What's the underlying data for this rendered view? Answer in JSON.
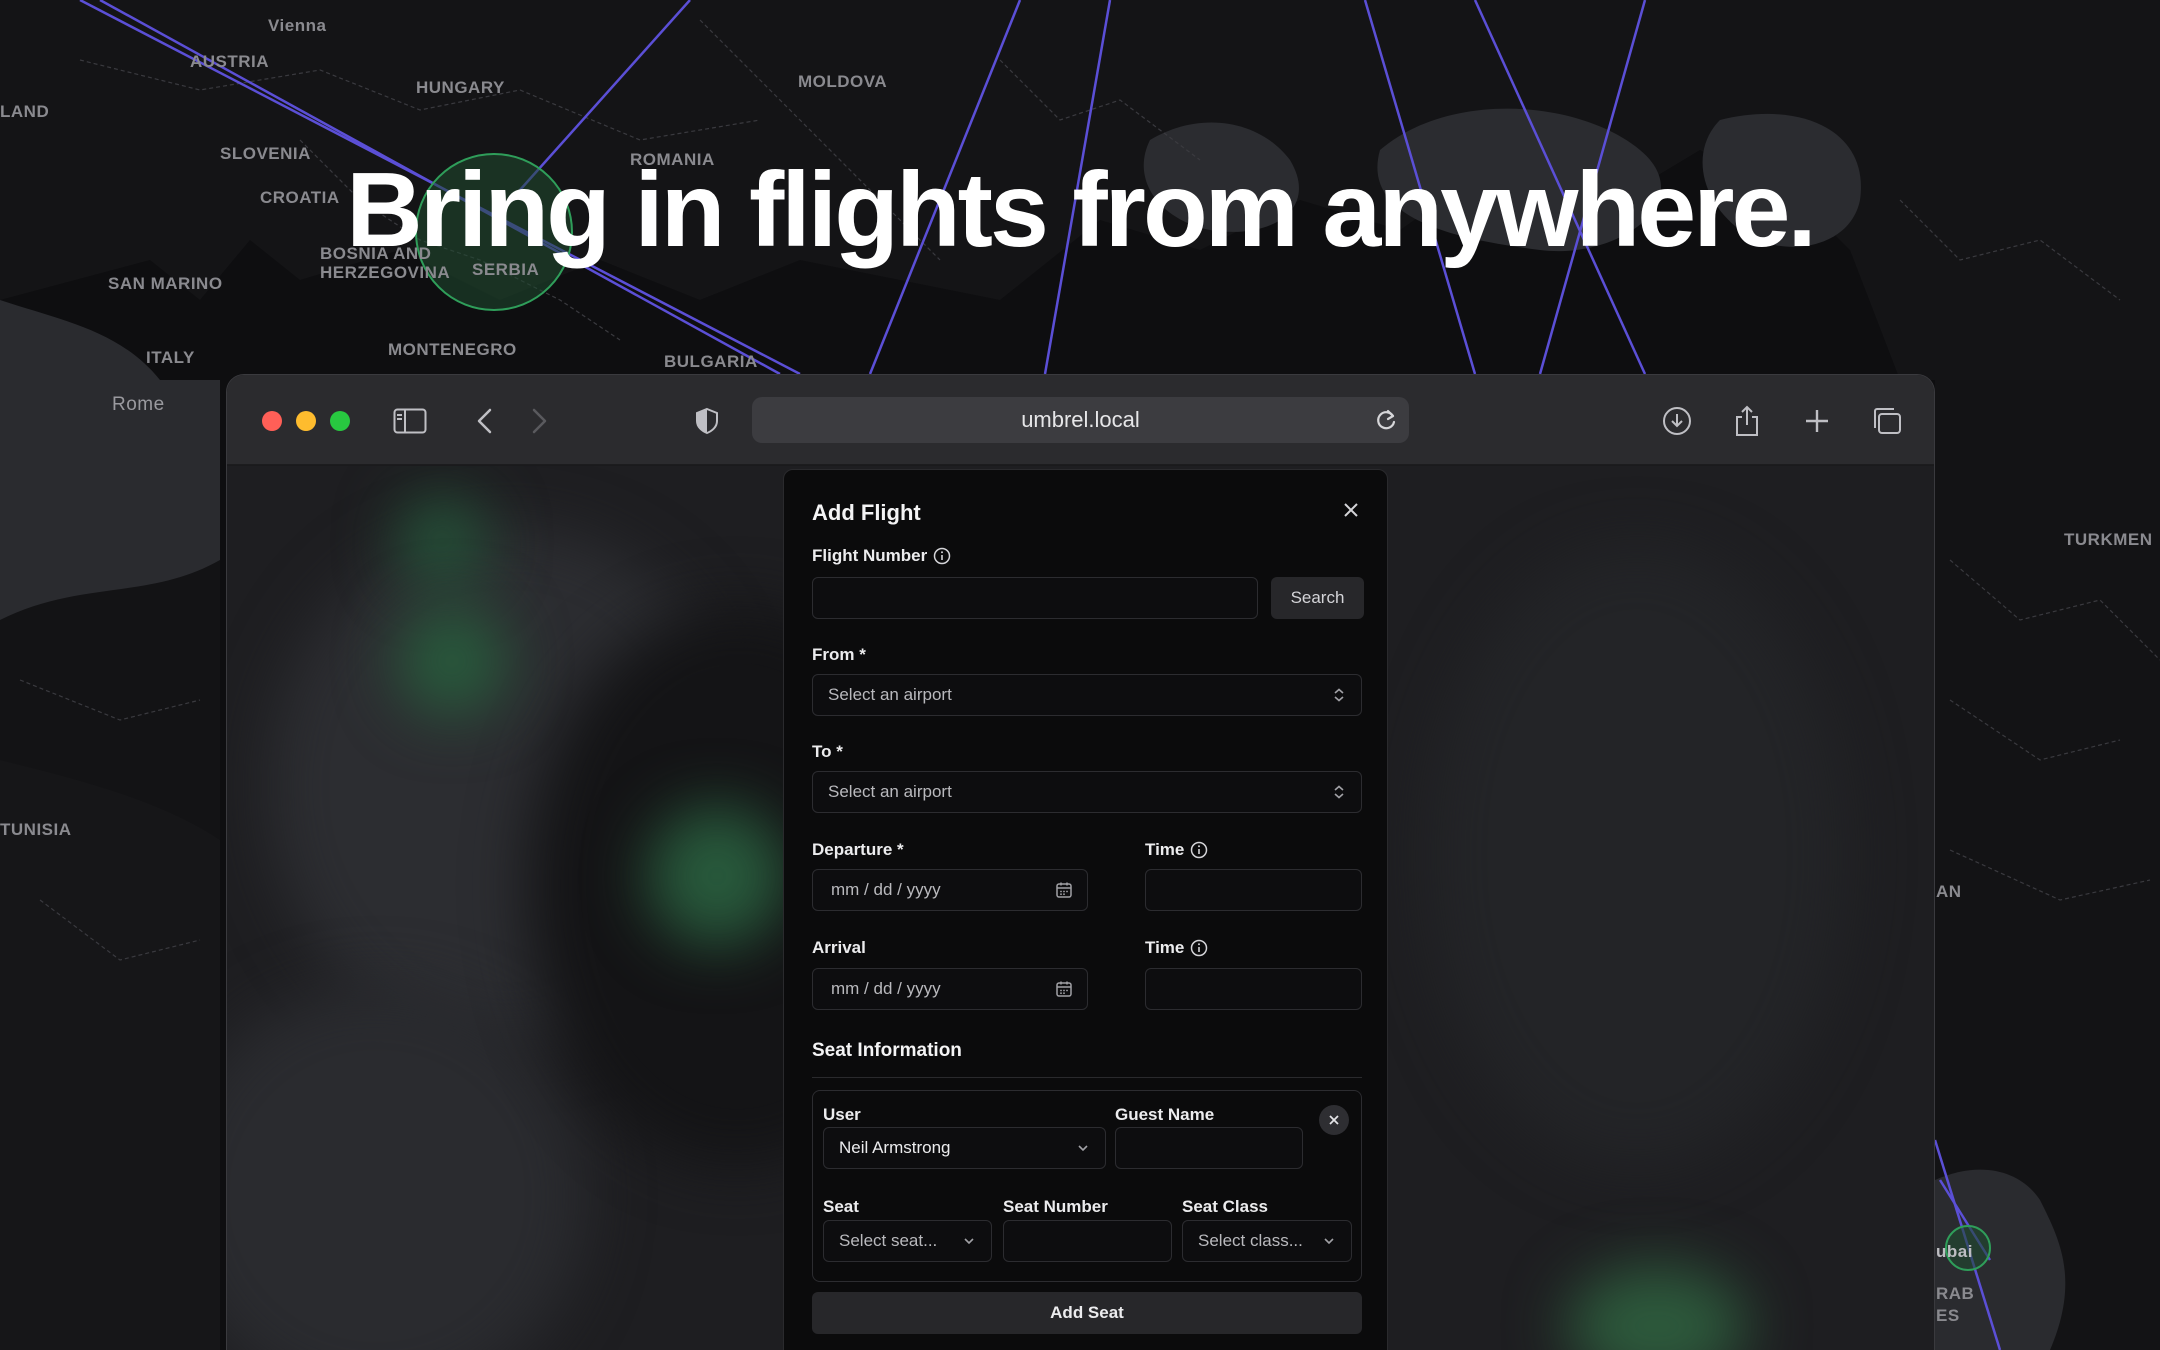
{
  "headline": "Bring in flights from anywhere.",
  "map_labels": {
    "vienna": "Vienna",
    "austria": "AUSTRIA",
    "hungary": "HUNGARY",
    "moldova": "MOLDOVA",
    "land": "LAND",
    "romania": "ROMANIA",
    "slovenia": "SLOVENIA",
    "croatia": "CROATIA",
    "bosnia": "BOSNIA AND\nHERZEGOVINA",
    "serbia": "SERBIA",
    "san_marino": "SAN MARINO",
    "italy": "ITALY",
    "montenegro": "MONTENEGRO",
    "bulgaria": "BULGARIA",
    "rome": "Rome",
    "turkmen": "TURKMEN",
    "tunisia": "TUNISIA",
    "an": "AN",
    "dubai": "ubai",
    "arab": "RAB",
    "es": "ES"
  },
  "browser": {
    "url": "umbrel.local"
  },
  "modal": {
    "title": "Add Flight",
    "flight_number_label": "Flight Number",
    "search_label": "Search",
    "from_label": "From *",
    "from_placeholder": "Select an airport",
    "to_label": "To *",
    "to_placeholder": "Select an airport",
    "departure_label": "Departure *",
    "departure_placeholder": "mm / dd / yyyy",
    "dep_time_label": "Time",
    "arrival_label": "Arrival",
    "arrival_placeholder": "mm / dd / yyyy",
    "arr_time_label": "Time",
    "seat_section_title": "Seat Information",
    "seat": {
      "user_label": "User",
      "user_value": "Neil Armstrong",
      "guest_name_label": "Guest Name",
      "seat_label": "Seat",
      "seat_placeholder": "Select seat...",
      "seat_number_label": "Seat Number",
      "seat_class_label": "Seat Class",
      "seat_class_placeholder": "Select class..."
    },
    "add_seat_label": "Add Seat"
  },
  "colors": {
    "flight_path": "#5b4fd6",
    "airport_marker": "#2f9e5a",
    "modal_bg": "#0b0b0c"
  }
}
